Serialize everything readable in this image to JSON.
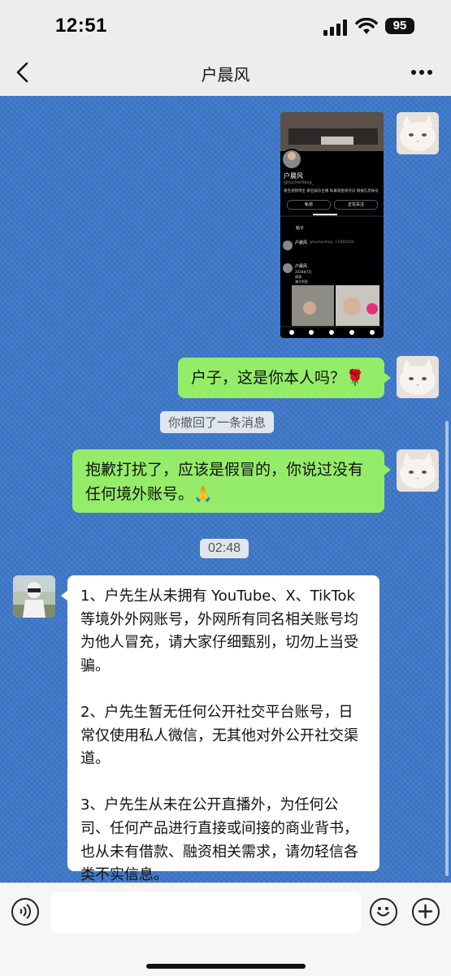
{
  "status": {
    "time": "12:51",
    "battery": "95"
  },
  "header": {
    "title": "户晨风"
  },
  "screenshot": {
    "name": "户晨风",
    "handle": "@huchenfeng_",
    "bio": "著名视频博主 著名娱乐主播 私募基金研究员 情报信息账号",
    "btn_msg": "私信",
    "btn_follow": "正在关注",
    "tab_posts": "帖子",
    "p1_name": "户晨风",
    "p1_meta": "@huchenfeng · 17/08/2026",
    "p2_name": "户晨风",
    "p2_line1": "2026年7月",
    "p2_line2": "周游",
    "p2_line3": "澳大利亚"
  },
  "messages": {
    "msg1": "户子，这是你本人吗？🌹",
    "recall": "你撤回了一条消息",
    "msg2": "抱歉打扰了，应该是假冒的，你说过没有任何境外账号。🙏",
    "time_divider": "02:48",
    "reply": "1、户先生从未拥有 YouTube、X、TikTok 等境外外网账号，外网所有同名相关账号均为他人冒充，请大家仔细甄别，切勿上当受骗。\n\n2、户先生暂无任何公开社交平台账号，日常仅使用私人微信，无其他对外公开社交渠道。\n\n3、户先生从未在公开直播外，为任何公司、任何产品进行直接或间接的商业背书，也从未有借款、融资相关需求，请勿轻信各类不实信息。"
  },
  "input": {
    "placeholder": ""
  },
  "icons": [
    "back-icon",
    "more-icon",
    "voice-icon",
    "emoji-icon",
    "add-icon"
  ]
}
